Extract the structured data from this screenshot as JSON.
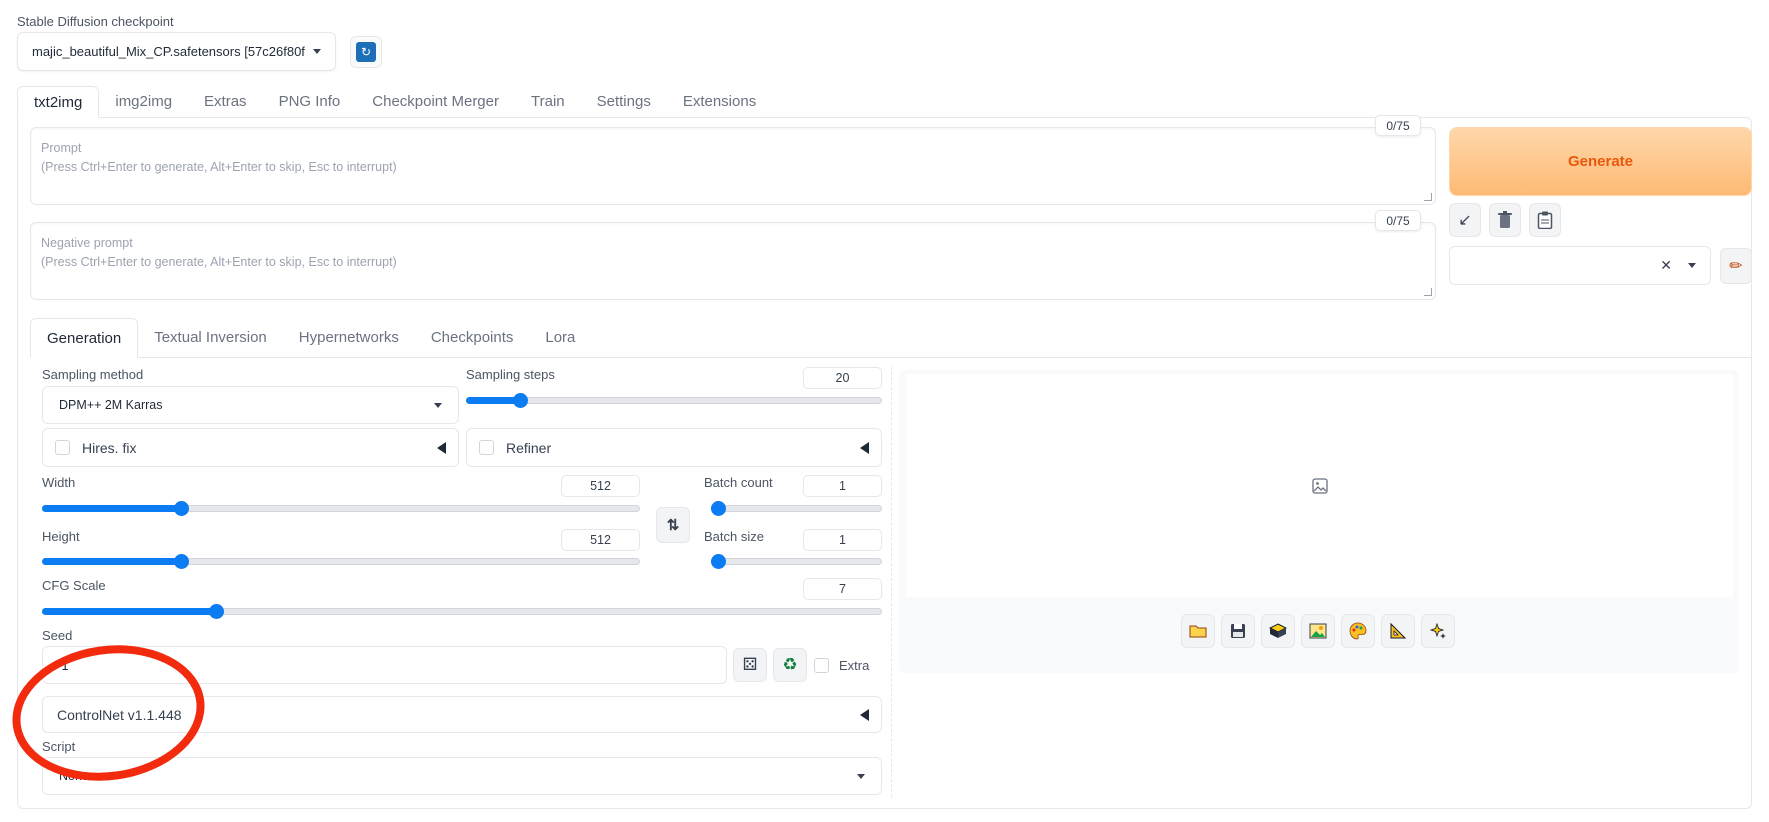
{
  "checkpoint": {
    "label": "Stable Diffusion checkpoint",
    "value": "majic_beautiful_Mix_CP.safetensors [57c26f80fl"
  },
  "main_tabs": [
    {
      "label": "txt2img"
    },
    {
      "label": "img2img"
    },
    {
      "label": "Extras"
    },
    {
      "label": "PNG Info"
    },
    {
      "label": "Checkpoint Merger"
    },
    {
      "label": "Train"
    },
    {
      "label": "Settings"
    },
    {
      "label": "Extensions"
    }
  ],
  "prompt": {
    "label": "Prompt",
    "placeholder": "(Press Ctrl+Enter to generate, Alt+Enter to skip, Esc to interrupt)",
    "token_count": "0/75"
  },
  "negative_prompt": {
    "label": "Negative prompt",
    "placeholder": "(Press Ctrl+Enter to generate, Alt+Enter to skip, Esc to interrupt)",
    "token_count": "0/75"
  },
  "generate_label": "Generate",
  "sub_tabs": [
    {
      "label": "Generation"
    },
    {
      "label": "Textual Inversion"
    },
    {
      "label": "Hypernetworks"
    },
    {
      "label": "Checkpoints"
    },
    {
      "label": "Lora"
    }
  ],
  "sampling": {
    "method_label": "Sampling method",
    "method_value": "DPM++ 2M Karras",
    "steps_label": "Sampling steps",
    "steps_value": "20",
    "steps_fraction": 0.13
  },
  "hires_label": "Hires. fix",
  "refiner_label": "Refiner",
  "width": {
    "label": "Width",
    "value": "512",
    "fraction": 0.233
  },
  "height": {
    "label": "Height",
    "value": "512",
    "fraction": 0.233
  },
  "batch_count": {
    "label": "Batch count",
    "value": "1",
    "fraction": 0.0
  },
  "batch_size": {
    "label": "Batch size",
    "value": "1",
    "fraction": 0.0
  },
  "cfg": {
    "label": "CFG Scale",
    "value": "7",
    "fraction": 0.207
  },
  "seed": {
    "label": "Seed",
    "value": "-1",
    "extra_label": "Extra"
  },
  "controlnet_label": "ControlNet v1.1.448",
  "script": {
    "label": "Script",
    "value": "None"
  },
  "accent_color": "#0c7cf2",
  "annotation_color": "#f22a0e",
  "icons": [
    "refresh-icon",
    "arrow-icon",
    "trash-icon",
    "clipboard-icon",
    "pencil-icon",
    "swap-icon",
    "dice-icon",
    "recycle-icon",
    "image-placeholder-icon",
    "folder-icon",
    "save-icon",
    "zip-icon",
    "image-icon",
    "palette-icon",
    "ruler-icon",
    "sparkle-icon"
  ]
}
